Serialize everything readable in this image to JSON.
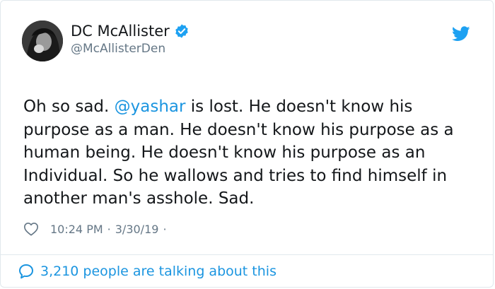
{
  "author": {
    "name": "DC McAllister",
    "handle": "@McAllisterDen",
    "verified": true
  },
  "tweet": {
    "text_before_mention": "Oh so sad. ",
    "mention": "@yashar",
    "text_after_mention": " is lost. He doesn't know his purpose as a man. He doesn't know his purpose as a human being. He doesn't know his purpose as an Individual. So he wallows and tries to find himself in another man's asshole. Sad."
  },
  "meta": {
    "time": "10:24 PM",
    "separator": "·",
    "date": "3/30/19",
    "trailing": "·"
  },
  "footer": {
    "talking_label": "3,210 people are talking about this"
  },
  "icons": {
    "verified": "verified-badge-icon",
    "twitter": "twitter-bird-icon",
    "like": "heart-icon",
    "reply": "speech-bubble-icon"
  },
  "colors": {
    "accent": "#1b95e0",
    "text": "#14171a",
    "muted": "#657786",
    "border": "#e1e8ed"
  }
}
